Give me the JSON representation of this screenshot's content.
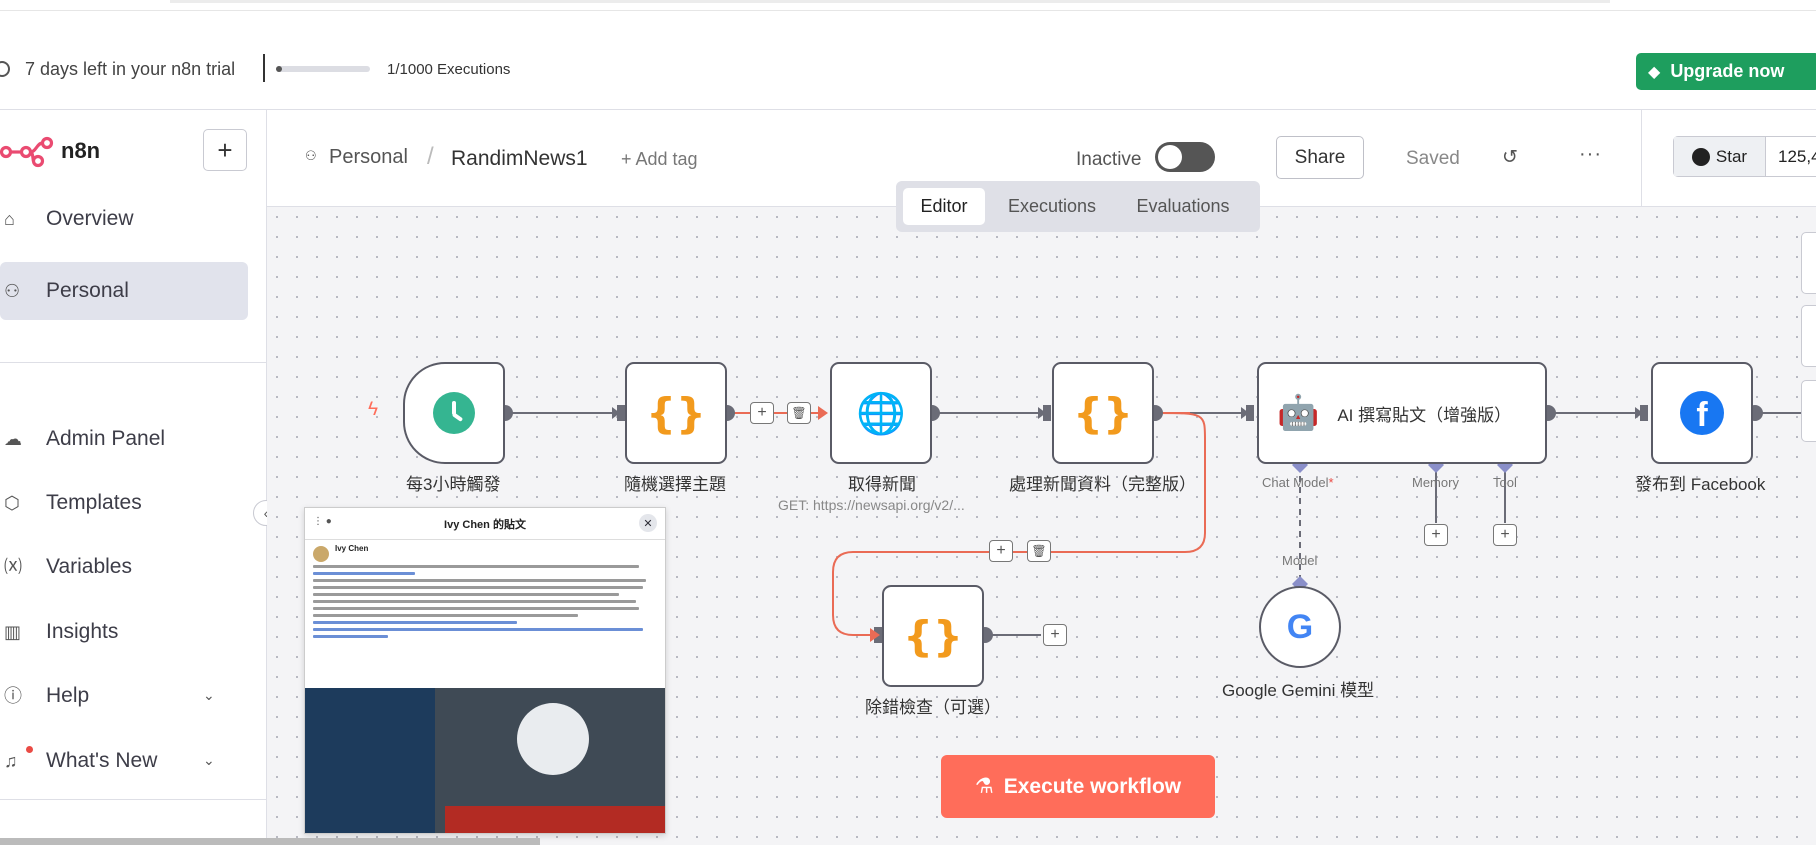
{
  "trial": {
    "text": "7 days left in your n8n trial",
    "executions_used": 1,
    "executions_limit": 1000,
    "executions_label": "1/1000 Executions",
    "upgrade_label": "Upgrade now"
  },
  "sidebar": {
    "brand": "n8n",
    "items": [
      {
        "label": "Overview",
        "icon": "home-icon"
      },
      {
        "label": "Personal",
        "icon": "user-icon",
        "active": true
      },
      {
        "label": "Admin Panel",
        "icon": "cloud-icon"
      },
      {
        "label": "Templates",
        "icon": "box-icon"
      },
      {
        "label": "Variables",
        "icon": "variable-icon"
      },
      {
        "label": "Insights",
        "icon": "chart-icon"
      },
      {
        "label": "Help",
        "icon": "help-icon"
      },
      {
        "label": "What's New",
        "icon": "bell-icon"
      }
    ]
  },
  "header": {
    "breadcrumb_project": "Personal",
    "workflow_name": "RandimNews1",
    "add_tag": "+ Add tag",
    "status_label": "Inactive",
    "share_label": "Share",
    "saved_label": "Saved",
    "star_label": "Star",
    "star_count": "125,4"
  },
  "tabs": [
    "Editor",
    "Executions",
    "Evaluations"
  ],
  "nodes": {
    "trigger": "每3小時觸發",
    "pick_topic": "隨機選擇主題",
    "fetch_news": "取得新聞",
    "fetch_news_sub": "GET: https://newsapi.org/v2/...",
    "process_news": "處理新聞資料（完整版）",
    "ai_writer": "AI 撰寫貼文（增強版）",
    "publish_fb": "發布到 Facebook",
    "debug_check": "除錯檢查（可選）",
    "gemini": "Google Gemini 模型"
  },
  "ai_ports": {
    "chat_model": "Chat Model",
    "required_mark": "*",
    "memory": "Memory",
    "tool": "Tool",
    "model": "Model"
  },
  "execute_label": "Execute workflow",
  "preview": {
    "title": "Ivy Chen 的貼文",
    "author": "Ivy Chen"
  },
  "colors": {
    "accent": "#ff6d5a",
    "upgrade": "#1e9e5e",
    "brand": "#ea4b71"
  }
}
